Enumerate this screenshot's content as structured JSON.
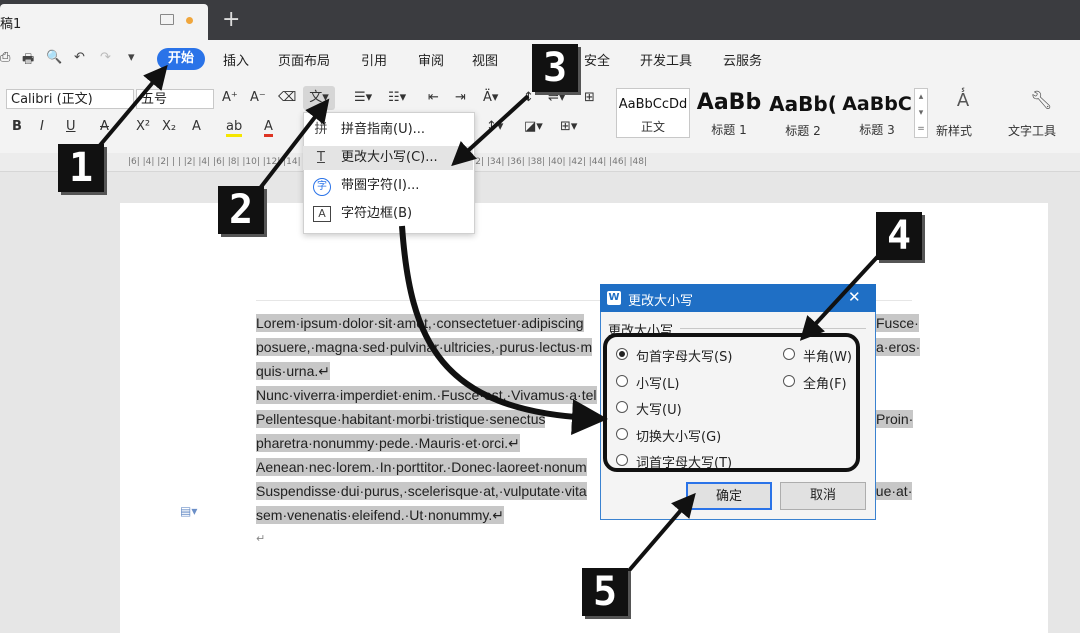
{
  "titlebar": {
    "doc_tab": "稿1",
    "new_tab": "+"
  },
  "quick_access": [
    "⎙",
    "🖶",
    "🔍",
    "↶",
    "↷",
    "▾"
  ],
  "menu": {
    "tabs": [
      "开始",
      "插入",
      "页面布局",
      "引用",
      "审阅",
      "视图",
      "安全",
      "开发工具",
      "云服务"
    ]
  },
  "ribbon": {
    "font_name": "Calibri (正文)",
    "font_size": "五号",
    "format_row": [
      "B",
      "I",
      "U",
      "A",
      "X²",
      "X₂",
      "A",
      "ab",
      "A"
    ],
    "styles": [
      {
        "sample": "AaBbCcDd",
        "name": "正文"
      },
      {
        "sample": "AaBb",
        "name": "标题 1"
      },
      {
        "sample": "AaBb(",
        "name": "标题 2"
      },
      {
        "sample": "AaBbC",
        "name": "标题 3"
      }
    ],
    "new_style": "新样式",
    "text_tools": "文字工具"
  },
  "ruler": "|6| |4| |2| | | |2| |4| |6| |8| |10| |12| |14| |16| |18| |20| |22| |24| |26| |28| |30| |32| |34| |36| |38| |40| |42| |44| |46| |48|",
  "dropdown": {
    "items": [
      {
        "icon": "拼",
        "label": "拼音指南(U)..."
      },
      {
        "icon": "T",
        "label": "更改大小写(C)..."
      },
      {
        "icon": "字",
        "label": "带圈字符(I)..."
      },
      {
        "icon": "A",
        "label": "字符边框(B)"
      }
    ]
  },
  "document": {
    "lines": [
      "Lorem·ipsum·dolor·sit·amet,·consectetuer·adipiscing",
      "posuere,·magna·sed·pulvinar·ultricies,·purus·lectus·m",
      "quis·urna.↵",
      "Nunc·viverra·imperdiet·enim.·Fusce·est.·Vivamus·a·tel",
      "Pellentesque·habitant·morbi·tristique·senectus",
      "pharetra·nonummy·pede.·Mauris·et·orci.↵",
      "Aenean·nec·lorem.·In·porttitor.·Donec·laoreet·nonum",
      "Suspendisse·dui·purus,·scelerisque·at,·vulputate·vita",
      "sem·venenatis·eleifend.·Ut·nonummy.↵"
    ],
    "right_fragments": [
      "Fusce·",
      "a·eros·",
      "Proin·",
      "que·at·"
    ],
    "end_mark": "↵"
  },
  "dialog": {
    "title": "更改大小写",
    "group_label": "更改大小写",
    "options_left": [
      {
        "label": "句首字母大写(S)",
        "selected": true
      },
      {
        "label": "小写(L)",
        "selected": false
      },
      {
        "label": "大写(U)",
        "selected": false
      },
      {
        "label": "切换大小写(G)",
        "selected": false
      },
      {
        "label": "词首字母大写(T)",
        "selected": false
      }
    ],
    "options_right": [
      {
        "label": "半角(W)",
        "selected": false
      },
      {
        "label": "全角(F)",
        "selected": false
      }
    ],
    "ok": "确定",
    "cancel": "取消",
    "close": "✕"
  },
  "callouts": [
    "1",
    "2",
    "3",
    "4",
    "5"
  ],
  "colors": {
    "accent": "#2a73e8",
    "dialog_title": "#1f6fc5",
    "callout": "#111111"
  }
}
